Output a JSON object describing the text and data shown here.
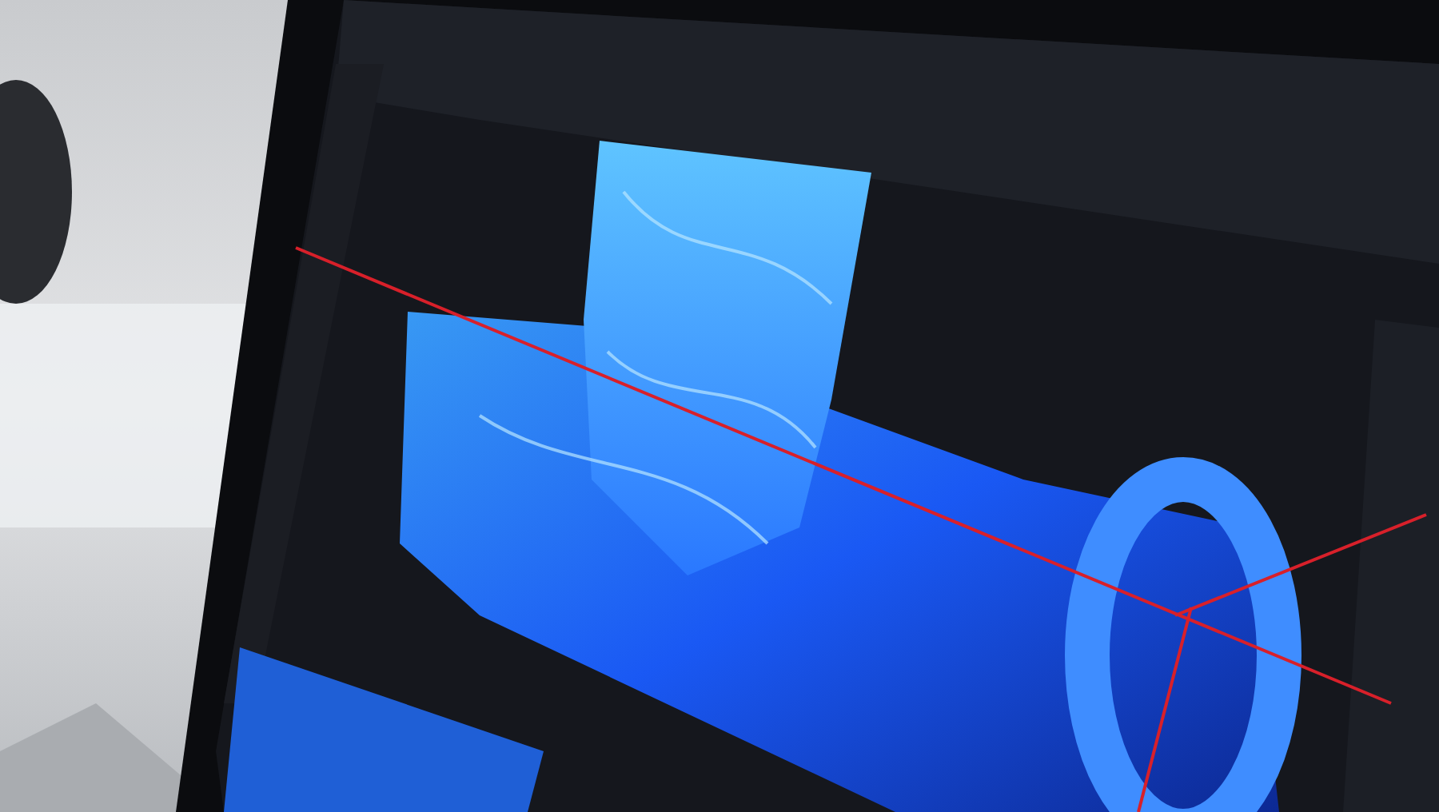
{
  "photo": {
    "kind": "laptop-screen"
  }
}
